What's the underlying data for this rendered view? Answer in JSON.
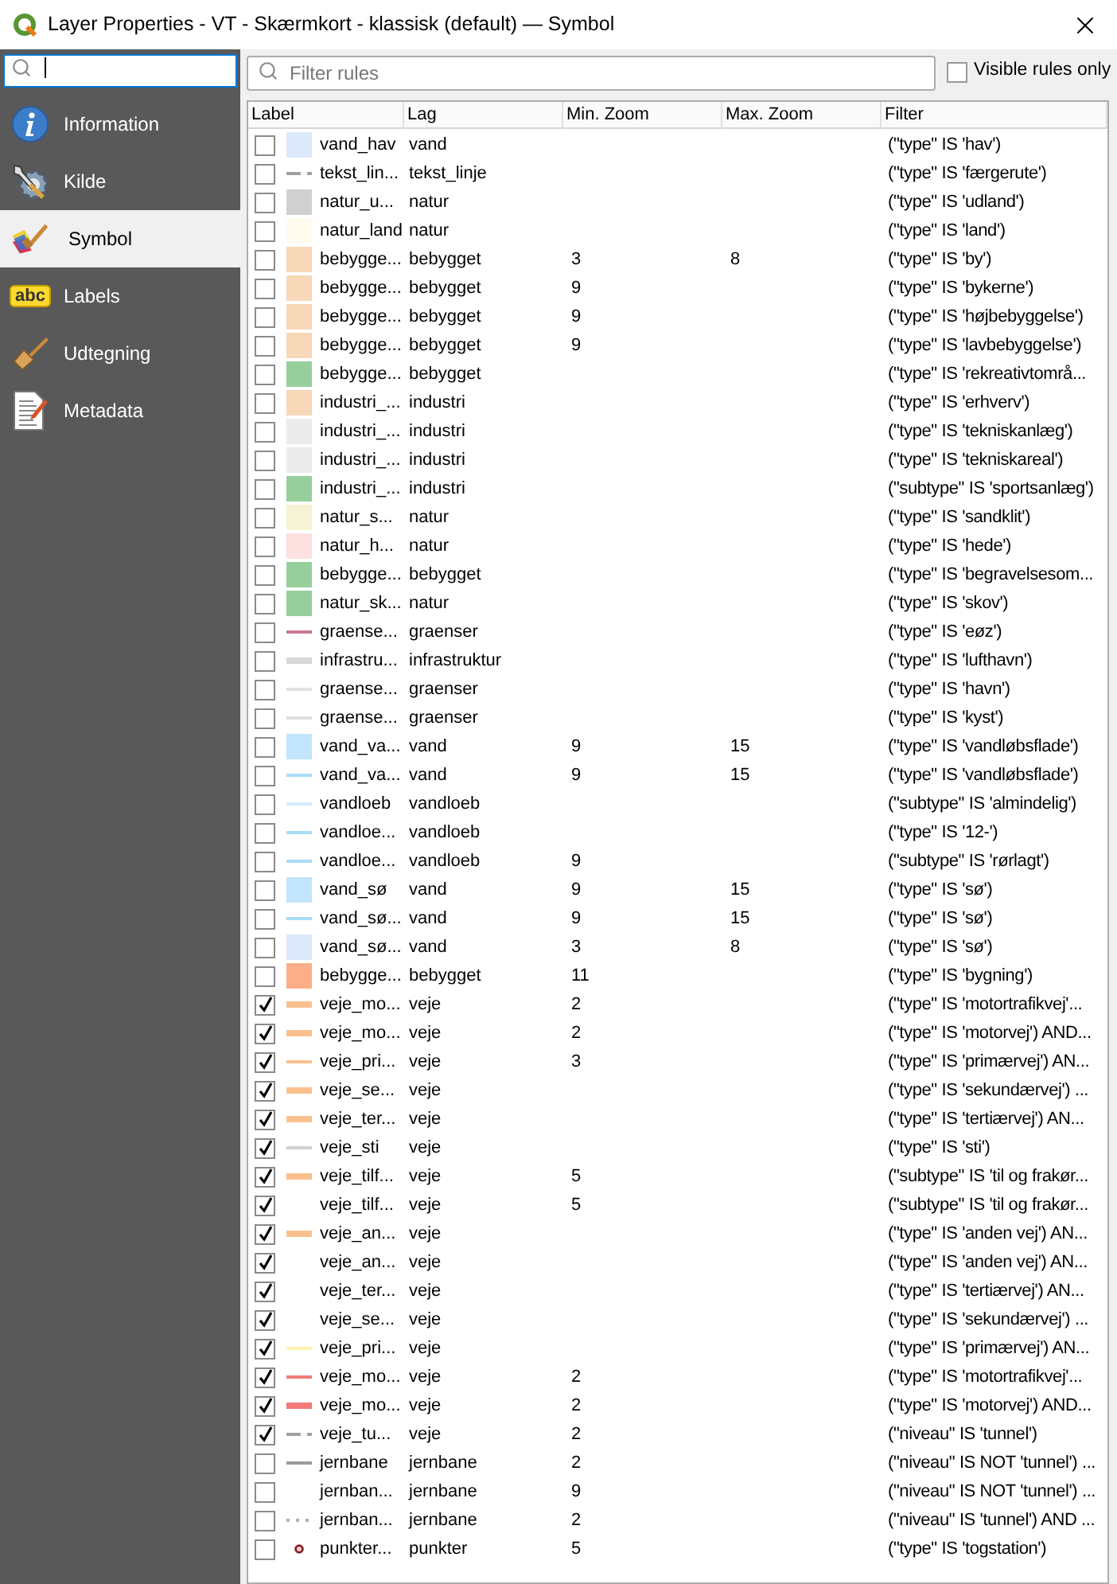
{
  "window": {
    "title": "Layer Properties - VT - Skærmkort - klassisk (default) — Symbol"
  },
  "sidebar": {
    "items": [
      {
        "label": "Information",
        "selected": false
      },
      {
        "label": "Kilde",
        "selected": false
      },
      {
        "label": "Symbol",
        "selected": true
      },
      {
        "label": "Labels",
        "icon_text": "abc",
        "selected": false
      },
      {
        "label": "Udtegning",
        "selected": false
      },
      {
        "label": "Metadata",
        "selected": false
      }
    ]
  },
  "filter": {
    "placeholder": "Filter rules",
    "visible_rules_only": {
      "label": "Visible rules only",
      "checked": false
    }
  },
  "table": {
    "columns": [
      "Label",
      "Lag",
      "Min. Zoom",
      "Max. Zoom",
      "Filter"
    ],
    "rows": [
      {
        "checked": false,
        "symbol": {
          "kind": "fill",
          "color": "#dbe9fb"
        },
        "label": "vand_hav",
        "layer": "vand",
        "min_zoom": "",
        "max_zoom": "",
        "filter": "(\"type\" IS 'hav')"
      },
      {
        "checked": false,
        "symbol": {
          "kind": "dash",
          "color": "#a0a0a0"
        },
        "label": "tekst_lin...",
        "layer": "tekst_linje",
        "min_zoom": "",
        "max_zoom": "",
        "filter": "(\"type\" IS 'færgerute')"
      },
      {
        "checked": false,
        "symbol": {
          "kind": "fill",
          "color": "#d0d0d0"
        },
        "label": "natur_u...",
        "layer": "natur",
        "min_zoom": "",
        "max_zoom": "",
        "filter": "(\"type\" IS 'udland')"
      },
      {
        "checked": false,
        "symbol": {
          "kind": "fill",
          "color": "#fffcee"
        },
        "label": "natur_land",
        "layer": "natur",
        "min_zoom": "",
        "max_zoom": "",
        "filter": "(\"type\" IS 'land')"
      },
      {
        "checked": false,
        "symbol": {
          "kind": "fill",
          "color": "#f7d8b8"
        },
        "label": "bebygge...",
        "layer": "bebygget",
        "min_zoom": "3",
        "max_zoom": "8",
        "filter": "(\"type\" IS 'by')"
      },
      {
        "checked": false,
        "symbol": {
          "kind": "fill",
          "color": "#f7d8b8"
        },
        "label": "bebygge...",
        "layer": "bebygget",
        "min_zoom": "9",
        "max_zoom": "",
        "filter": "(\"type\" IS 'bykerne')"
      },
      {
        "checked": false,
        "symbol": {
          "kind": "fill",
          "color": "#f7d8b8"
        },
        "label": "bebygge...",
        "layer": "bebygget",
        "min_zoom": "9",
        "max_zoom": "",
        "filter": "(\"type\" IS 'højbebyggelse')"
      },
      {
        "checked": false,
        "symbol": {
          "kind": "fill",
          "color": "#f7d8b8"
        },
        "label": "bebygge...",
        "layer": "bebygget",
        "min_zoom": "9",
        "max_zoom": "",
        "filter": "(\"type\" IS 'lavbebyggelse')"
      },
      {
        "checked": false,
        "symbol": {
          "kind": "fill",
          "color": "#97cf9c"
        },
        "label": "bebygge...",
        "layer": "bebygget",
        "min_zoom": "",
        "max_zoom": "",
        "filter": "(\"type\" IS 'rekreativtområ..."
      },
      {
        "checked": false,
        "symbol": {
          "kind": "fill",
          "color": "#f7d8b8"
        },
        "label": "industri_...",
        "layer": "industri",
        "min_zoom": "",
        "max_zoom": "",
        "filter": "(\"type\" IS 'erhverv')"
      },
      {
        "checked": false,
        "symbol": {
          "kind": "fill",
          "color": "#ebebeb"
        },
        "label": "industri_...",
        "layer": "industri",
        "min_zoom": "",
        "max_zoom": "",
        "filter": "(\"type\" IS 'tekniskanlæg')"
      },
      {
        "checked": false,
        "symbol": {
          "kind": "fill",
          "color": "#ebebeb"
        },
        "label": "industri_...",
        "layer": "industri",
        "min_zoom": "",
        "max_zoom": "",
        "filter": "(\"type\" IS 'tekniskareal')"
      },
      {
        "checked": false,
        "symbol": {
          "kind": "fill",
          "color": "#97cf9c"
        },
        "label": "industri_...",
        "layer": "industri",
        "min_zoom": "",
        "max_zoom": "",
        "filter": "(\"subtype\" IS 'sportsanlæg')"
      },
      {
        "checked": false,
        "symbol": {
          "kind": "fill",
          "color": "#f5f3d3"
        },
        "label": "natur_s...",
        "layer": "natur",
        "min_zoom": "",
        "max_zoom": "",
        "filter": "(\"type\" IS 'sandklit')"
      },
      {
        "checked": false,
        "symbol": {
          "kind": "fill",
          "color": "#fde0e0"
        },
        "label": "natur_h...",
        "layer": "natur",
        "min_zoom": "",
        "max_zoom": "",
        "filter": "(\"type\" IS 'hede')"
      },
      {
        "checked": false,
        "symbol": {
          "kind": "fill",
          "color": "#97cf9c"
        },
        "label": "bebygge...",
        "layer": "bebygget",
        "min_zoom": "",
        "max_zoom": "",
        "filter": "(\"type\" IS 'begravelsesom..."
      },
      {
        "checked": false,
        "symbol": {
          "kind": "fill",
          "color": "#97cf9c"
        },
        "label": "natur_sk...",
        "layer": "natur",
        "min_zoom": "",
        "max_zoom": "",
        "filter": "(\"type\" IS 'skov')"
      },
      {
        "checked": false,
        "symbol": {
          "kind": "line",
          "color": "#c97a9a"
        },
        "label": "graense...",
        "layer": "graenser",
        "min_zoom": "",
        "max_zoom": "",
        "filter": "(\"type\" IS 'eøz')"
      },
      {
        "checked": false,
        "symbol": {
          "kind": "band",
          "color": "#d8d8d8"
        },
        "label": "infrastru...",
        "layer": "infrastruktur",
        "min_zoom": "",
        "max_zoom": "",
        "filter": "(\"type\" IS 'lufthavn')"
      },
      {
        "checked": false,
        "symbol": {
          "kind": "line",
          "color": "#e0e0e0"
        },
        "label": "graense...",
        "layer": "graenser",
        "min_zoom": "",
        "max_zoom": "",
        "filter": "(\"type\" IS 'havn')"
      },
      {
        "checked": false,
        "symbol": {
          "kind": "line",
          "color": "#e0e0e0"
        },
        "label": "graense...",
        "layer": "graenser",
        "min_zoom": "",
        "max_zoom": "",
        "filter": "(\"type\" IS 'kyst')"
      },
      {
        "checked": false,
        "symbol": {
          "kind": "fill",
          "color": "#c2e5fb"
        },
        "label": "vand_va...",
        "layer": "vand",
        "min_zoom": "9",
        "max_zoom": "15",
        "filter": "(\"type\" IS 'vandløbsflade')"
      },
      {
        "checked": false,
        "symbol": {
          "kind": "line",
          "color": "#a8dcf5"
        },
        "label": "vand_va...",
        "layer": "vand",
        "min_zoom": "9",
        "max_zoom": "15",
        "filter": "(\"type\" IS 'vandløbsflade')"
      },
      {
        "checked": false,
        "symbol": {
          "kind": "line",
          "color": "#d5ecf8"
        },
        "label": "vandloeb",
        "layer": "vandloeb",
        "min_zoom": "",
        "max_zoom": "",
        "filter": "(\"subtype\" IS 'almindelig')"
      },
      {
        "checked": false,
        "symbol": {
          "kind": "line",
          "color": "#a8dcf5"
        },
        "label": "vandloe...",
        "layer": "vandloeb",
        "min_zoom": "",
        "max_zoom": "",
        "filter": "(\"type\" IS '12-')"
      },
      {
        "checked": false,
        "symbol": {
          "kind": "line",
          "color": "#a8dcf5"
        },
        "label": "vandloe...",
        "layer": "vandloeb",
        "min_zoom": "9",
        "max_zoom": "",
        "filter": "(\"subtype\" IS 'rørlagt')"
      },
      {
        "checked": false,
        "symbol": {
          "kind": "fill",
          "color": "#c2e5fb"
        },
        "label": "vand_sø",
        "layer": "vand",
        "min_zoom": "9",
        "max_zoom": "15",
        "filter": "(\"type\" IS 'sø')"
      },
      {
        "checked": false,
        "symbol": {
          "kind": "line",
          "color": "#a8dcf5"
        },
        "label": "vand_sø...",
        "layer": "vand",
        "min_zoom": "9",
        "max_zoom": "15",
        "filter": "(\"type\" IS 'sø')"
      },
      {
        "checked": false,
        "symbol": {
          "kind": "fill",
          "color": "#dbe9fb"
        },
        "label": "vand_sø...",
        "layer": "vand",
        "min_zoom": "3",
        "max_zoom": "8",
        "filter": "(\"type\" IS 'sø')"
      },
      {
        "checked": false,
        "symbol": {
          "kind": "fill",
          "color": "#fcae88"
        },
        "label": "bebygge...",
        "layer": "bebygget",
        "min_zoom": "11",
        "max_zoom": "",
        "filter": "(\"type\" IS 'bygning')"
      },
      {
        "checked": true,
        "symbol": {
          "kind": "band",
          "color": "#f9c08e"
        },
        "label": "veje_mo...",
        "layer": "veje",
        "min_zoom": "2",
        "max_zoom": "",
        "filter": "(\"type\" IS 'motortrafikvej'..."
      },
      {
        "checked": true,
        "symbol": {
          "kind": "band",
          "color": "#f9c08e"
        },
        "label": "veje_mo...",
        "layer": "veje",
        "min_zoom": "2",
        "max_zoom": "",
        "filter": "(\"type\" IS 'motorvej') AND..."
      },
      {
        "checked": true,
        "symbol": {
          "kind": "line",
          "color": "#f9c08e"
        },
        "label": "veje_pri...",
        "layer": "veje",
        "min_zoom": "3",
        "max_zoom": "",
        "filter": "(\"type\" IS 'primærvej') AN..."
      },
      {
        "checked": true,
        "symbol": {
          "kind": "band",
          "color": "#f9c08e"
        },
        "label": "veje_se...",
        "layer": "veje",
        "min_zoom": "",
        "max_zoom": "",
        "filter": "(\"type\" IS 'sekundærvej') ..."
      },
      {
        "checked": true,
        "symbol": {
          "kind": "band",
          "color": "#f9c08e"
        },
        "label": "veje_ter...",
        "layer": "veje",
        "min_zoom": "",
        "max_zoom": "",
        "filter": "(\"type\" IS 'tertiærvej') AN..."
      },
      {
        "checked": true,
        "symbol": {
          "kind": "line",
          "color": "#d0d0d0"
        },
        "label": "veje_sti",
        "layer": "veje",
        "min_zoom": "",
        "max_zoom": "",
        "filter": "(\"type\" IS 'sti')"
      },
      {
        "checked": true,
        "symbol": {
          "kind": "band",
          "color": "#f9c08e"
        },
        "label": "veje_tilf...",
        "layer": "veje",
        "min_zoom": "5",
        "max_zoom": "",
        "filter": "(\"subtype\" IS 'til og frakør..."
      },
      {
        "checked": true,
        "symbol": {
          "kind": "none"
        },
        "label": "veje_tilf...",
        "layer": "veje",
        "min_zoom": "5",
        "max_zoom": "",
        "filter": "(\"subtype\" IS 'til og frakør..."
      },
      {
        "checked": true,
        "symbol": {
          "kind": "band",
          "color": "#f9c08e"
        },
        "label": "veje_an...",
        "layer": "veje",
        "min_zoom": "",
        "max_zoom": "",
        "filter": "(\"type\" IS 'anden vej') AN..."
      },
      {
        "checked": true,
        "symbol": {
          "kind": "none"
        },
        "label": "veje_an...",
        "layer": "veje",
        "min_zoom": "",
        "max_zoom": "",
        "filter": "(\"type\" IS 'anden vej') AN..."
      },
      {
        "checked": true,
        "symbol": {
          "kind": "none"
        },
        "label": "veje_ter...",
        "layer": "veje",
        "min_zoom": "",
        "max_zoom": "",
        "filter": "(\"type\" IS 'tertiærvej') AN..."
      },
      {
        "checked": true,
        "symbol": {
          "kind": "none"
        },
        "label": "veje_se...",
        "layer": "veje",
        "min_zoom": "",
        "max_zoom": "",
        "filter": "(\"type\" IS 'sekundærvej') ..."
      },
      {
        "checked": true,
        "symbol": {
          "kind": "line",
          "color": "#fff4b0"
        },
        "label": "veje_pri...",
        "layer": "veje",
        "min_zoom": "",
        "max_zoom": "",
        "filter": "(\"type\" IS 'primærvej') AN..."
      },
      {
        "checked": true,
        "symbol": {
          "kind": "line",
          "color": "#f47a7a"
        },
        "label": "veje_mo...",
        "layer": "veje",
        "min_zoom": "2",
        "max_zoom": "",
        "filter": "(\"type\" IS 'motortrafikvej'..."
      },
      {
        "checked": true,
        "symbol": {
          "kind": "band",
          "color": "#f47a7a"
        },
        "label": "veje_mo...",
        "layer": "veje",
        "min_zoom": "2",
        "max_zoom": "",
        "filter": "(\"type\" IS 'motorvej') AND..."
      },
      {
        "checked": true,
        "symbol": {
          "kind": "dash",
          "color": "#a0a0a0"
        },
        "label": "veje_tu...",
        "layer": "veje",
        "min_zoom": "2",
        "max_zoom": "",
        "filter": "(\"niveau\" IS 'tunnel')"
      },
      {
        "checked": false,
        "symbol": {
          "kind": "line",
          "color": "#9a9a9a"
        },
        "label": "jernbane",
        "layer": "jernbane",
        "min_zoom": "2",
        "max_zoom": "",
        "filter": "(\"niveau\" IS NOT 'tunnel') ..."
      },
      {
        "checked": false,
        "symbol": {
          "kind": "none"
        },
        "label": "jernban...",
        "layer": "jernbane",
        "min_zoom": "9",
        "max_zoom": "",
        "filter": "(\"niveau\" IS NOT 'tunnel') ..."
      },
      {
        "checked": false,
        "symbol": {
          "kind": "dots",
          "color": "#b0b0b0"
        },
        "label": "jernban...",
        "layer": "jernbane",
        "min_zoom": "2",
        "max_zoom": "",
        "filter": "(\"niveau\" IS 'tunnel') AND ..."
      },
      {
        "checked": false,
        "symbol": {
          "kind": "marker",
          "color": "#8b2020"
        },
        "label": "punkter...",
        "layer": "punkter",
        "min_zoom": "5",
        "max_zoom": "",
        "filter": "(\"type\" IS 'togstation')"
      }
    ]
  }
}
